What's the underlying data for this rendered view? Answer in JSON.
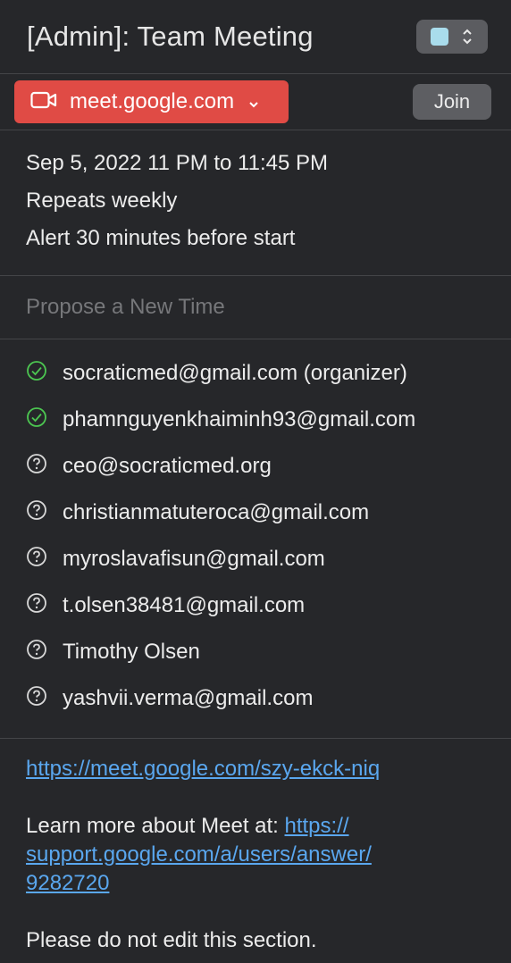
{
  "header": {
    "title": "[Admin]: Team Meeting",
    "calendar_color": "#a9dcec"
  },
  "meeting": {
    "service_label": "meet.google.com",
    "join_label": "Join",
    "accent": "#e04b45"
  },
  "details": {
    "date_time": "Sep 5, 2022  11 PM to 11:45 PM",
    "repeat": "Repeats weekly",
    "alert": "Alert 30 minutes before start"
  },
  "propose": {
    "label": "Propose a New Time"
  },
  "attendees": [
    {
      "email": "socraticmed@gmail.com (organizer)",
      "status": "accepted"
    },
    {
      "email": "phamnguyenkhaiminh93@gmail.com",
      "status": "accepted"
    },
    {
      "email": "ceo@socraticmed.org",
      "status": "unknown"
    },
    {
      "email": "christianmatuteroca@gmail.com",
      "status": "unknown"
    },
    {
      "email": "myroslavafisun@gmail.com",
      "status": "unknown"
    },
    {
      "email": "t.olsen38481@gmail.com",
      "status": "unknown"
    },
    {
      "email": "Timothy Olsen",
      "status": "unknown"
    },
    {
      "email": "yashvii.verma@gmail.com",
      "status": "unknown"
    }
  ],
  "notes": {
    "meet_link": "https://meet.google.com/szy-ekck-niq",
    "learn_prefix": "Learn more about Meet at: ",
    "learn_link_1": "https://",
    "learn_link_2": "support.google.com/a/users/answer/",
    "learn_link_3": "9282720",
    "footer": "Please do not edit this section."
  }
}
